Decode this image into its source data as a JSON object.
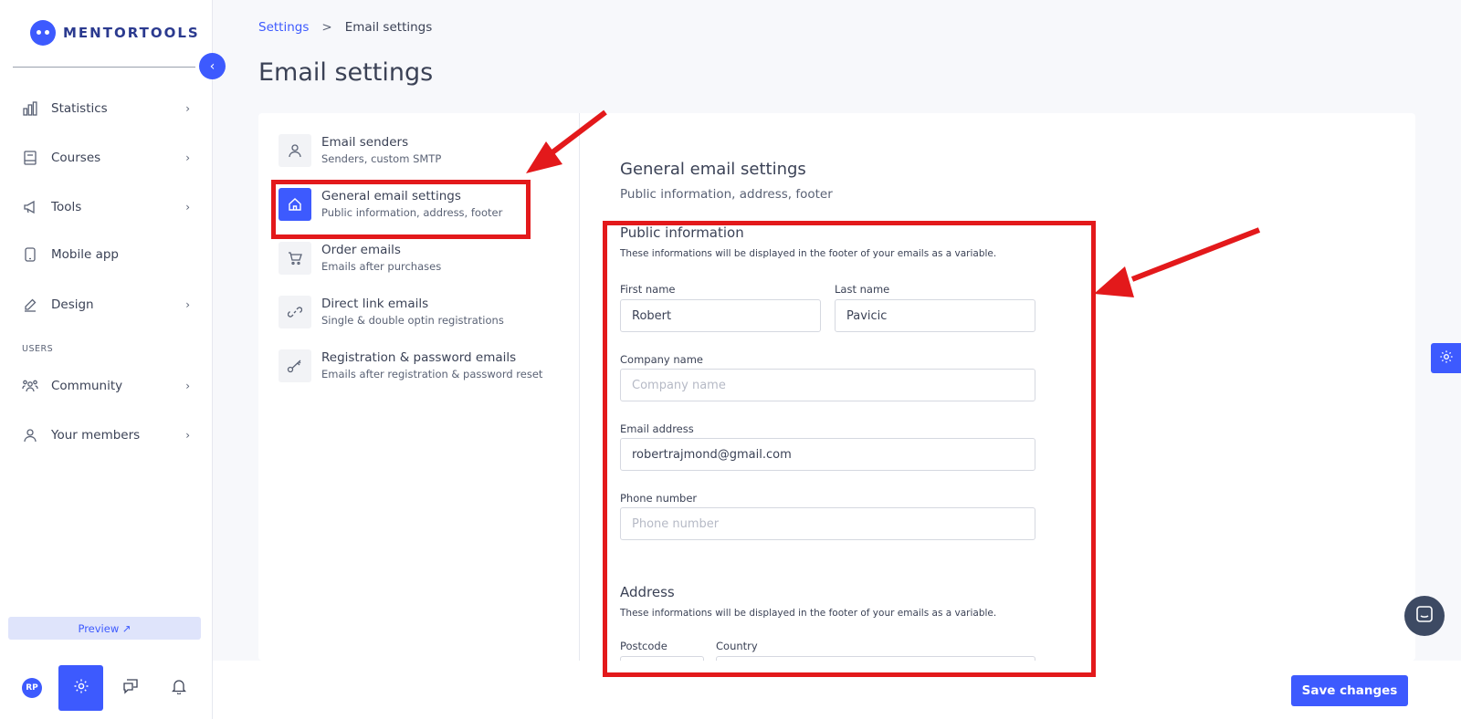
{
  "brand": {
    "name": "MENTORTOOLS"
  },
  "sidebar": {
    "items": [
      {
        "label": "Statistics",
        "icon": "bar-chart-icon"
      },
      {
        "label": "Courses",
        "icon": "book-icon"
      },
      {
        "label": "Tools",
        "icon": "megaphone-icon"
      },
      {
        "label": "Mobile app",
        "icon": "phone-icon"
      },
      {
        "label": "Design",
        "icon": "pencil-icon"
      }
    ],
    "users_label": "USERS",
    "user_items": [
      {
        "label": "Community",
        "icon": "people-icon"
      },
      {
        "label": "Your members",
        "icon": "user-icon"
      }
    ],
    "preview_label": "Preview ↗",
    "avatar_initials": "RP"
  },
  "breadcrumb": {
    "parent": "Settings",
    "separator": ">",
    "current": "Email settings"
  },
  "page_title": "Email settings",
  "settings_menu": [
    {
      "title": "Email senders",
      "subtitle": "Senders, custom SMTP",
      "icon": "user-icon"
    },
    {
      "title": "General email settings",
      "subtitle": "Public information, address, footer",
      "icon": "home-icon",
      "active": true
    },
    {
      "title": "Order emails",
      "subtitle": "Emails after purchases",
      "icon": "cart-icon"
    },
    {
      "title": "Direct link emails",
      "subtitle": "Single & double optin registrations",
      "icon": "link-icon"
    },
    {
      "title": "Registration & password emails",
      "subtitle": "Emails after registration & password reset",
      "icon": "key-icon"
    }
  ],
  "content": {
    "title": "General email settings",
    "subtitle": "Public information, address, footer",
    "public_info": {
      "title": "Public information",
      "subtitle": "These informations will be displayed in the footer of your emails as a variable.",
      "first_name": {
        "label": "First name",
        "value": "Robert"
      },
      "last_name": {
        "label": "Last name",
        "value": "Pavicic"
      },
      "company": {
        "label": "Company name",
        "value": "",
        "placeholder": "Company name"
      },
      "email": {
        "label": "Email address",
        "value": "robertrajmond@gmail.com"
      },
      "phone": {
        "label": "Phone number",
        "value": "",
        "placeholder": "Phone number"
      }
    },
    "address": {
      "title": "Address",
      "subtitle": "These informations will be displayed in the footer of your emails as a variable.",
      "postcode_label": "Postcode",
      "country_label": "Country"
    }
  },
  "save_label": "Save changes",
  "colors": {
    "accent": "#3d5afe",
    "annotation": "#e3191b"
  }
}
